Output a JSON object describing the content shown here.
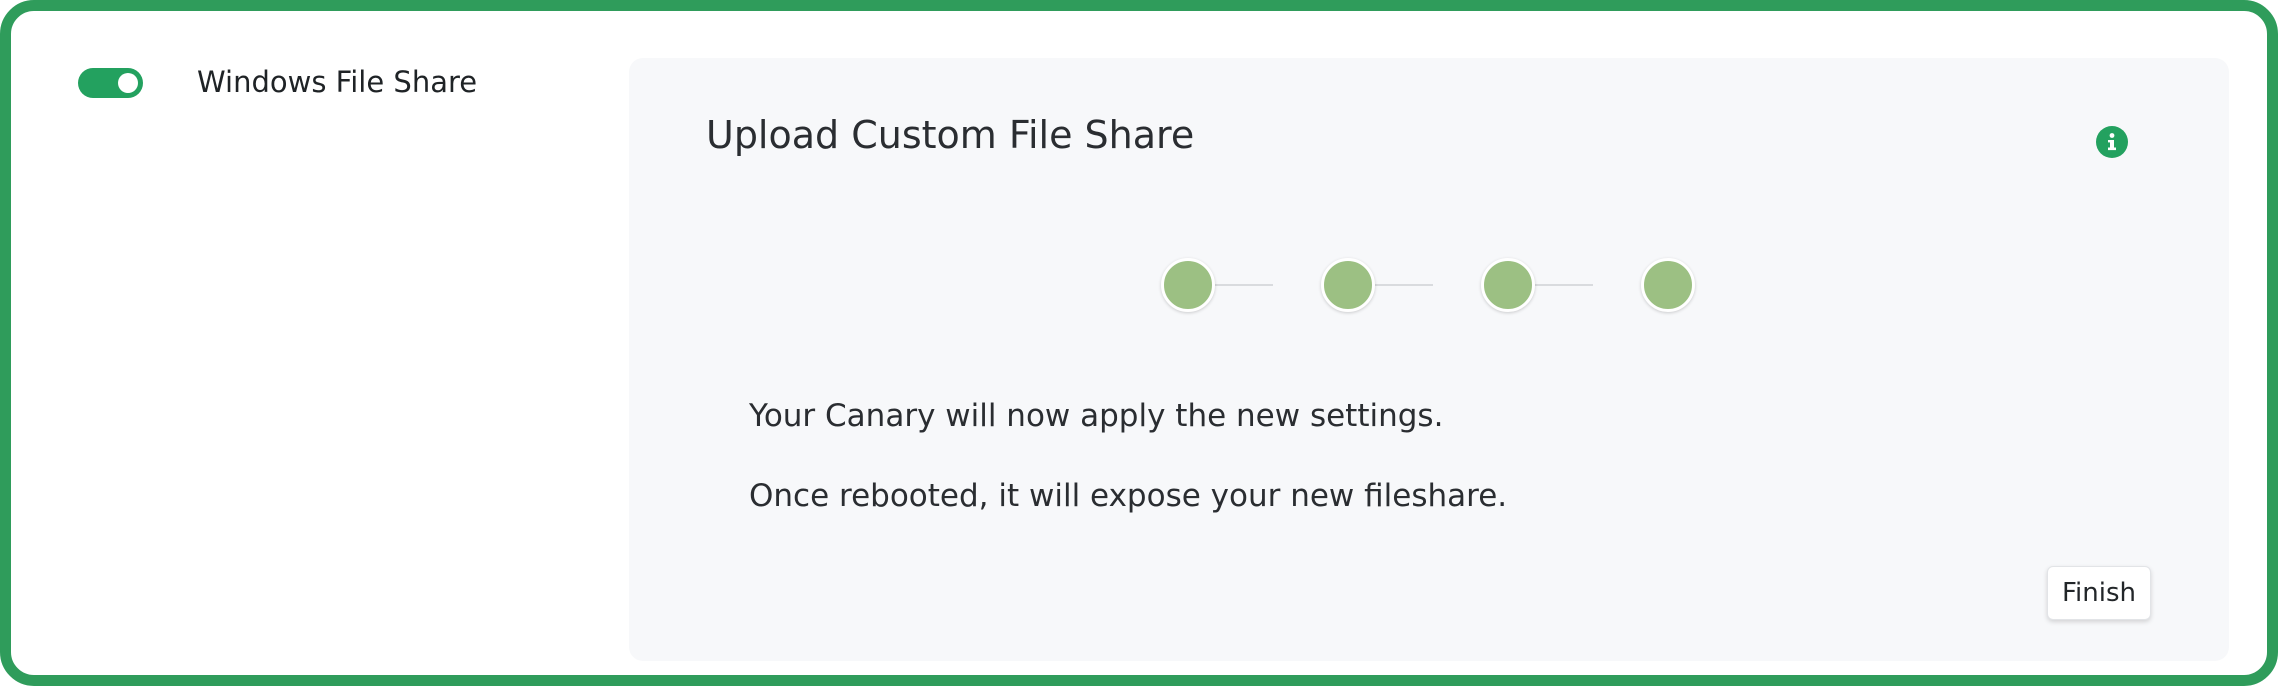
{
  "colors": {
    "frame": "#2f9c5b",
    "accent": "#23a15f",
    "step_complete": "#9cc083",
    "panel_bg": "#f7f8fa"
  },
  "service": {
    "label": "Windows File Share",
    "enabled": true
  },
  "wizard": {
    "title": "Upload Custom File Share",
    "info_icon": "info-icon",
    "steps": [
      {
        "state": "complete"
      },
      {
        "state": "complete"
      },
      {
        "state": "complete"
      },
      {
        "state": "complete"
      }
    ],
    "messages": [
      "Your Canary will now apply the new settings.",
      "Once rebooted, it will expose your new fileshare."
    ],
    "finish_label": "Finish"
  }
}
